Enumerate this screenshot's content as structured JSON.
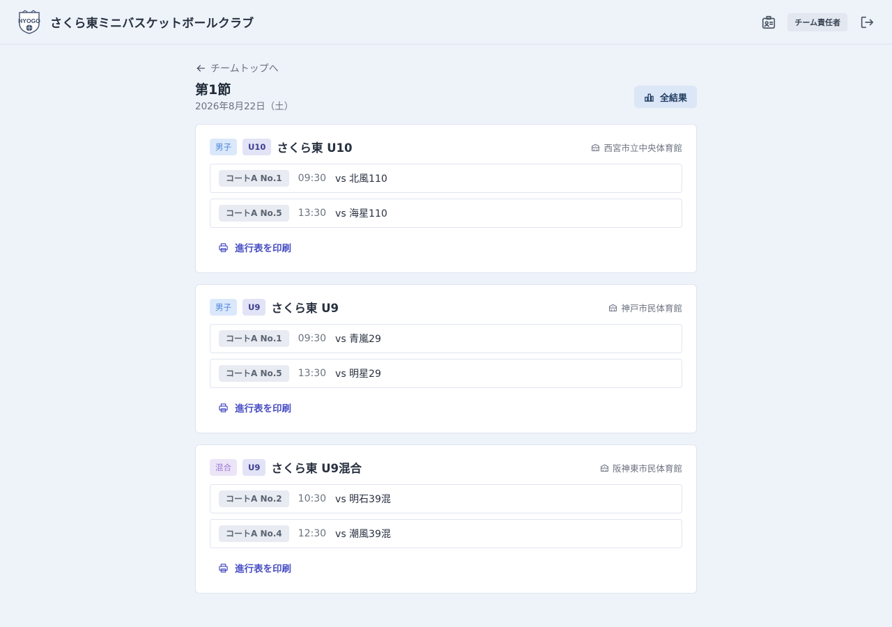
{
  "header": {
    "app_title": "さくら東ミニバスケットボールクラブ",
    "logo_text": "HYOGO",
    "role_label": "チーム責任者"
  },
  "main": {
    "back_label": "チームトップへ",
    "title": "第1節",
    "date": "2026年8月22日（土）",
    "all_results_label": "全結果"
  },
  "cards": [
    {
      "gender_tag": "男子",
      "age_tag": "U10",
      "team_name": "さくら東 U10",
      "venue": "西宮市立中央体育館",
      "matches": [
        {
          "court": "コートA No.1",
          "time": "09:30",
          "opponent": "vs 北風110"
        },
        {
          "court": "コートA No.5",
          "time": "13:30",
          "opponent": "vs 海星110"
        }
      ],
      "print_label": "進行表を印刷"
    },
    {
      "gender_tag": "男子",
      "age_tag": "U9",
      "team_name": "さくら東 U9",
      "venue": "神戸市民体育館",
      "matches": [
        {
          "court": "コートA No.1",
          "time": "09:30",
          "opponent": "vs 青嵐29"
        },
        {
          "court": "コートA No.5",
          "time": "13:30",
          "opponent": "vs 明星29"
        }
      ],
      "print_label": "進行表を印刷"
    },
    {
      "gender_tag": "混合",
      "age_tag": "U9",
      "team_name": "さくら東 U9混合",
      "venue": "阪神東市民体育館",
      "matches": [
        {
          "court": "コートA No.2",
          "time": "10:30",
          "opponent": "vs 明石39混"
        },
        {
          "court": "コートA No.4",
          "time": "12:30",
          "opponent": "vs 潮風39混"
        }
      ],
      "print_label": "進行表を印刷"
    }
  ],
  "icons": {
    "back": "arrow-left-icon",
    "results": "bar-chart-icon",
    "venue": "building-icon",
    "print": "printer-icon",
    "id_card": "id-card-icon",
    "logout": "logout-icon"
  },
  "colors": {
    "accent": "#4a4fc4",
    "background": "#eef2f9",
    "boys_tag": "#4a86d8",
    "mixed_tag": "#9d7bd3",
    "age_tag": "#3b3f8f"
  }
}
